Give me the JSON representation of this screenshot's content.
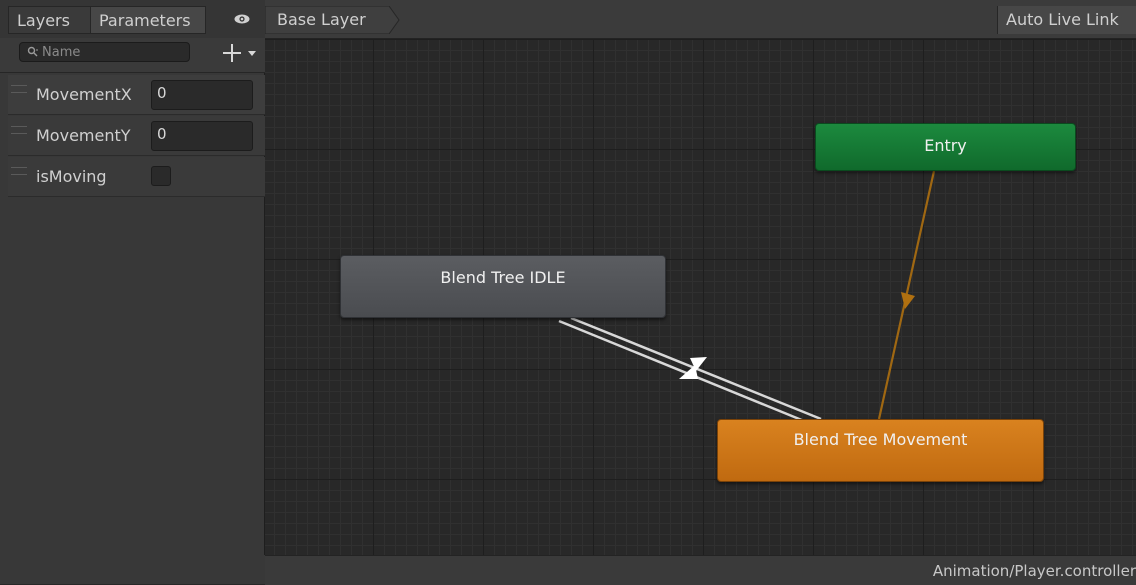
{
  "left_panel": {
    "tabs": {
      "layers": "Layers",
      "parameters": "Parameters"
    },
    "search": {
      "placeholder": "Name"
    },
    "add_button": "+",
    "parameters": [
      {
        "name": "MovementX",
        "type": "float",
        "value": "0"
      },
      {
        "name": "MovementY",
        "type": "float",
        "value": "0"
      },
      {
        "name": "isMoving",
        "type": "bool",
        "value": false
      }
    ]
  },
  "top_bar": {
    "breadcrumb": "Base Layer",
    "live_link": "Auto Live Link"
  },
  "graph": {
    "nodes": [
      {
        "id": "entry",
        "label": "Entry",
        "color": "#1c8a3e"
      },
      {
        "id": "idle",
        "label": "Blend Tree IDLE",
        "color": "#5b5d61"
      },
      {
        "id": "movement",
        "label": "Blend Tree Movement",
        "color": "#d9821f"
      }
    ],
    "transition_colors": {
      "default": "#d8d8d8",
      "entry": "#b07010"
    }
  },
  "status_bar": {
    "path": "Animation/Player.controller"
  }
}
